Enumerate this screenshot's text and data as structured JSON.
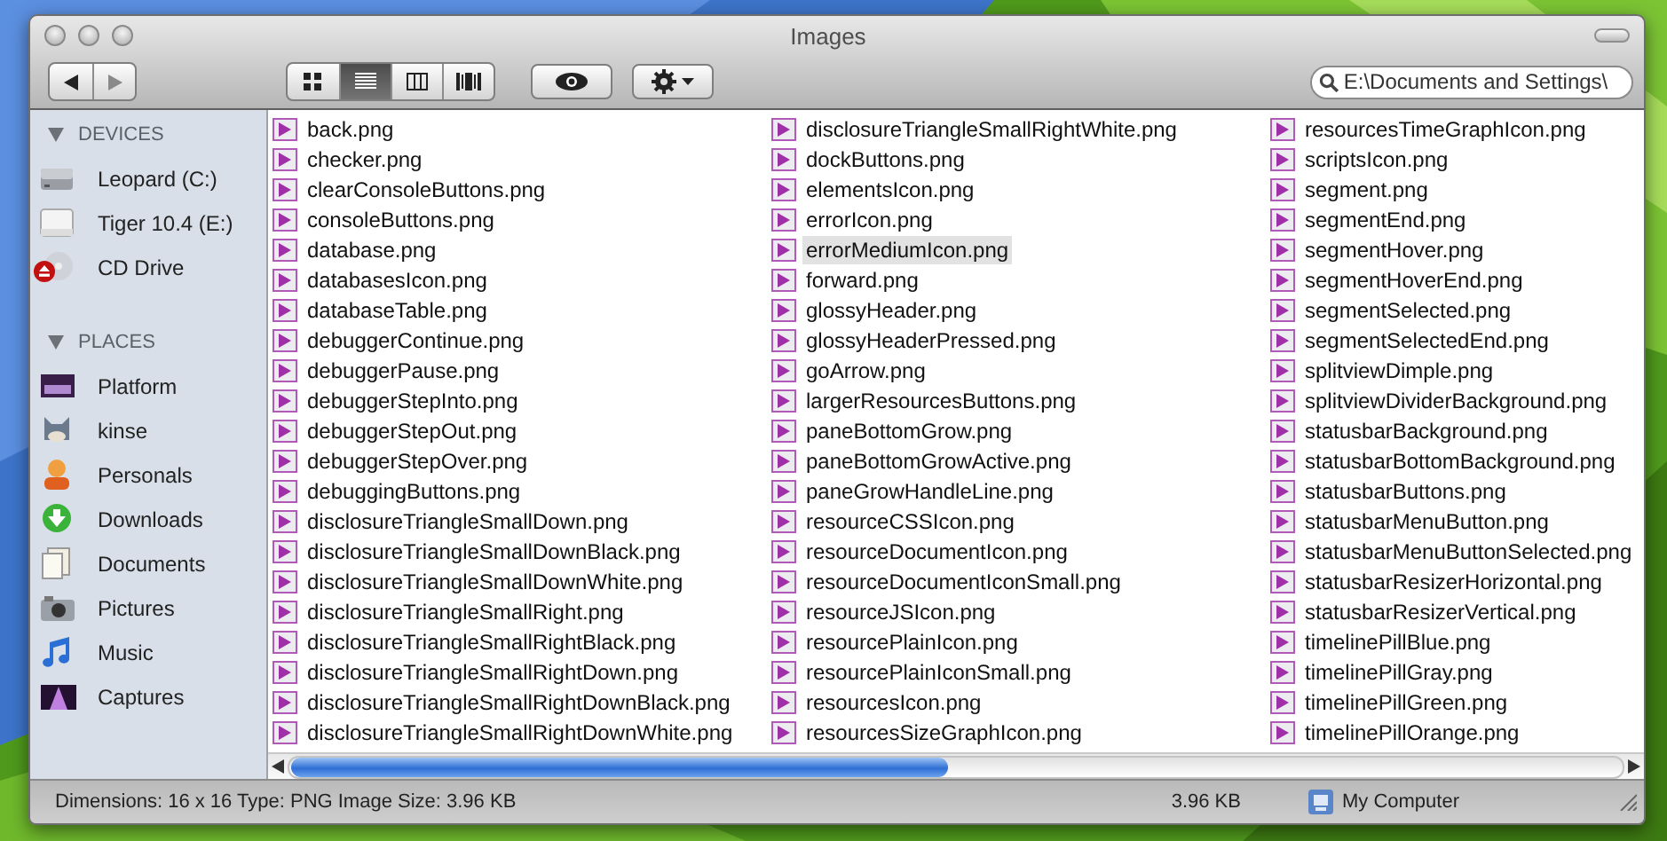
{
  "window": {
    "title": "Images"
  },
  "toolbar": {
    "views": [
      {
        "kind": "icons",
        "selected": false
      },
      {
        "kind": "list",
        "selected": true
      },
      {
        "kind": "columns",
        "selected": false
      },
      {
        "kind": "coverflow",
        "selected": false
      }
    ],
    "search": {
      "value": "E:\\Documents and Settings\\"
    }
  },
  "sidebar": {
    "sections": [
      {
        "title": "DEVICES",
        "expanded": true,
        "items": [
          {
            "label": "Leopard (C:)",
            "eject": false
          },
          {
            "label": "Tiger 10.4 (E:)",
            "eject": false
          },
          {
            "label": "CD Drive",
            "eject": true
          }
        ]
      },
      {
        "title": "PLACES",
        "expanded": true,
        "items": [
          {
            "label": "Platform",
            "eject": false
          },
          {
            "label": "kinse",
            "eject": false
          },
          {
            "label": "Personals",
            "eject": false
          },
          {
            "label": "Downloads",
            "eject": false
          },
          {
            "label": "Documents",
            "eject": false
          },
          {
            "label": "Pictures",
            "eject": false
          },
          {
            "label": "Music",
            "eject": false
          },
          {
            "label": "Captures",
            "eject": false
          }
        ]
      }
    ]
  },
  "files": [
    {
      "name": "back.png",
      "selected": false
    },
    {
      "name": "checker.png",
      "selected": false
    },
    {
      "name": "clearConsoleButtons.png",
      "selected": false
    },
    {
      "name": "consoleButtons.png",
      "selected": false
    },
    {
      "name": "database.png",
      "selected": false
    },
    {
      "name": "databasesIcon.png",
      "selected": false
    },
    {
      "name": "databaseTable.png",
      "selected": false
    },
    {
      "name": "debuggerContinue.png",
      "selected": false
    },
    {
      "name": "debuggerPause.png",
      "selected": false
    },
    {
      "name": "debuggerStepInto.png",
      "selected": false
    },
    {
      "name": "debuggerStepOut.png",
      "selected": false
    },
    {
      "name": "debuggerStepOver.png",
      "selected": false
    },
    {
      "name": "debuggingButtons.png",
      "selected": false
    },
    {
      "name": "disclosureTriangleSmallDown.png",
      "selected": false
    },
    {
      "name": "disclosureTriangleSmallDownBlack.png",
      "selected": false
    },
    {
      "name": "disclosureTriangleSmallDownWhite.png",
      "selected": false
    },
    {
      "name": "disclosureTriangleSmallRight.png",
      "selected": false
    },
    {
      "name": "disclosureTriangleSmallRightBlack.png",
      "selected": false
    },
    {
      "name": "disclosureTriangleSmallRightDown.png",
      "selected": false
    },
    {
      "name": "disclosureTriangleSmallRightDownBlack.png",
      "selected": false
    },
    {
      "name": "disclosureTriangleSmallRightDownWhite.png",
      "selected": false
    },
    {
      "name": "disclosureTriangleSmallRightWhite.png",
      "selected": false
    },
    {
      "name": "dockButtons.png",
      "selected": false
    },
    {
      "name": "elementsIcon.png",
      "selected": false
    },
    {
      "name": "errorIcon.png",
      "selected": false
    },
    {
      "name": "errorMediumIcon.png",
      "selected": true
    },
    {
      "name": "forward.png",
      "selected": false
    },
    {
      "name": "glossyHeader.png",
      "selected": false
    },
    {
      "name": "glossyHeaderPressed.png",
      "selected": false
    },
    {
      "name": "goArrow.png",
      "selected": false
    },
    {
      "name": "largerResourcesButtons.png",
      "selected": false
    },
    {
      "name": "paneBottomGrow.png",
      "selected": false
    },
    {
      "name": "paneBottomGrowActive.png",
      "selected": false
    },
    {
      "name": "paneGrowHandleLine.png",
      "selected": false
    },
    {
      "name": "resourceCSSIcon.png",
      "selected": false
    },
    {
      "name": "resourceDocumentIcon.png",
      "selected": false
    },
    {
      "name": "resourceDocumentIconSmall.png",
      "selected": false
    },
    {
      "name": "resourceJSIcon.png",
      "selected": false
    },
    {
      "name": "resourcePlainIcon.png",
      "selected": false
    },
    {
      "name": "resourcePlainIconSmall.png",
      "selected": false
    },
    {
      "name": "resourcesIcon.png",
      "selected": false
    },
    {
      "name": "resourcesSizeGraphIcon.png",
      "selected": false
    },
    {
      "name": "resourcesTimeGraphIcon.png",
      "selected": false
    },
    {
      "name": "scriptsIcon.png",
      "selected": false
    },
    {
      "name": "segment.png",
      "selected": false
    },
    {
      "name": "segmentEnd.png",
      "selected": false
    },
    {
      "name": "segmentHover.png",
      "selected": false
    },
    {
      "name": "segmentHoverEnd.png",
      "selected": false
    },
    {
      "name": "segmentSelected.png",
      "selected": false
    },
    {
      "name": "segmentSelectedEnd.png",
      "selected": false
    },
    {
      "name": "splitviewDimple.png",
      "selected": false
    },
    {
      "name": "splitviewDividerBackground.png",
      "selected": false
    },
    {
      "name": "statusbarBackground.png",
      "selected": false
    },
    {
      "name": "statusbarBottomBackground.png",
      "selected": false
    },
    {
      "name": "statusbarButtons.png",
      "selected": false
    },
    {
      "name": "statusbarMenuButton.png",
      "selected": false
    },
    {
      "name": "statusbarMenuButtonSelected.png",
      "selected": false
    },
    {
      "name": "statusbarResizerHorizontal.png",
      "selected": false
    },
    {
      "name": "statusbarResizerVertical.png",
      "selected": false
    },
    {
      "name": "timelinePillBlue.png",
      "selected": false
    },
    {
      "name": "timelinePillGray.png",
      "selected": false
    },
    {
      "name": "timelinePillGreen.png",
      "selected": false
    },
    {
      "name": "timelinePillOrange.png",
      "selected": false
    }
  ],
  "status_bar": {
    "info": "Dimensions: 16 x 16 Type: PNG Image Size: 3.96 KB",
    "size": "3.96 KB",
    "location": "My Computer"
  }
}
